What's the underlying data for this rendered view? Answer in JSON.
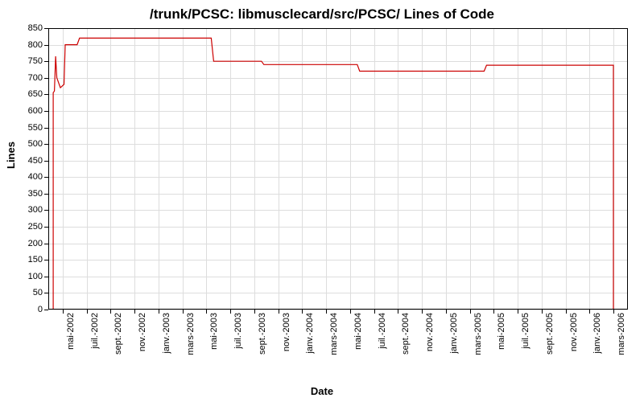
{
  "chart_data": {
    "type": "line",
    "title": "/trunk/PCSC: libmusclecard/src/PCSC/ Lines of Code",
    "xlabel": "Date",
    "ylabel": "Lines",
    "ylim": [
      0,
      850
    ],
    "y_ticks": [
      0,
      50,
      100,
      150,
      200,
      250,
      300,
      350,
      400,
      450,
      500,
      550,
      600,
      650,
      700,
      750,
      800,
      850
    ],
    "x_categories": [
      "mai-2002",
      "juil.-2002",
      "sept.-2002",
      "nov.-2002",
      "janv.-2003",
      "mars-2003",
      "mai-2003",
      "juil.-2003",
      "sept.-2003",
      "nov.-2003",
      "janv.-2004",
      "mars-2004",
      "mai-2004",
      "juil.-2004",
      "sept.-2004",
      "nov.-2004",
      "janv.-2005",
      "mars-2005",
      "mai-2005",
      "juil.-2005",
      "sept.-2005",
      "nov.-2005",
      "janv.-2006",
      "mars-2006"
    ],
    "series": [
      {
        "name": "Lines of Code",
        "color": "#cc0000",
        "points": [
          {
            "xi": -0.4,
            "y": 0
          },
          {
            "xi": -0.4,
            "y": 655
          },
          {
            "xi": -0.35,
            "y": 660
          },
          {
            "xi": -0.3,
            "y": 765
          },
          {
            "xi": -0.25,
            "y": 700
          },
          {
            "xi": -0.1,
            "y": 670
          },
          {
            "xi": 0.05,
            "y": 680
          },
          {
            "xi": 0.1,
            "y": 800
          },
          {
            "xi": 0.6,
            "y": 800
          },
          {
            "xi": 0.7,
            "y": 820
          },
          {
            "xi": 6.2,
            "y": 820
          },
          {
            "xi": 6.3,
            "y": 750
          },
          {
            "xi": 8.3,
            "y": 750
          },
          {
            "xi": 8.4,
            "y": 740
          },
          {
            "xi": 12.3,
            "y": 740
          },
          {
            "xi": 12.4,
            "y": 720
          },
          {
            "xi": 17.6,
            "y": 720
          },
          {
            "xi": 17.7,
            "y": 738
          },
          {
            "xi": 23.0,
            "y": 738
          },
          {
            "xi": 23.0,
            "y": 0
          }
        ]
      }
    ]
  }
}
